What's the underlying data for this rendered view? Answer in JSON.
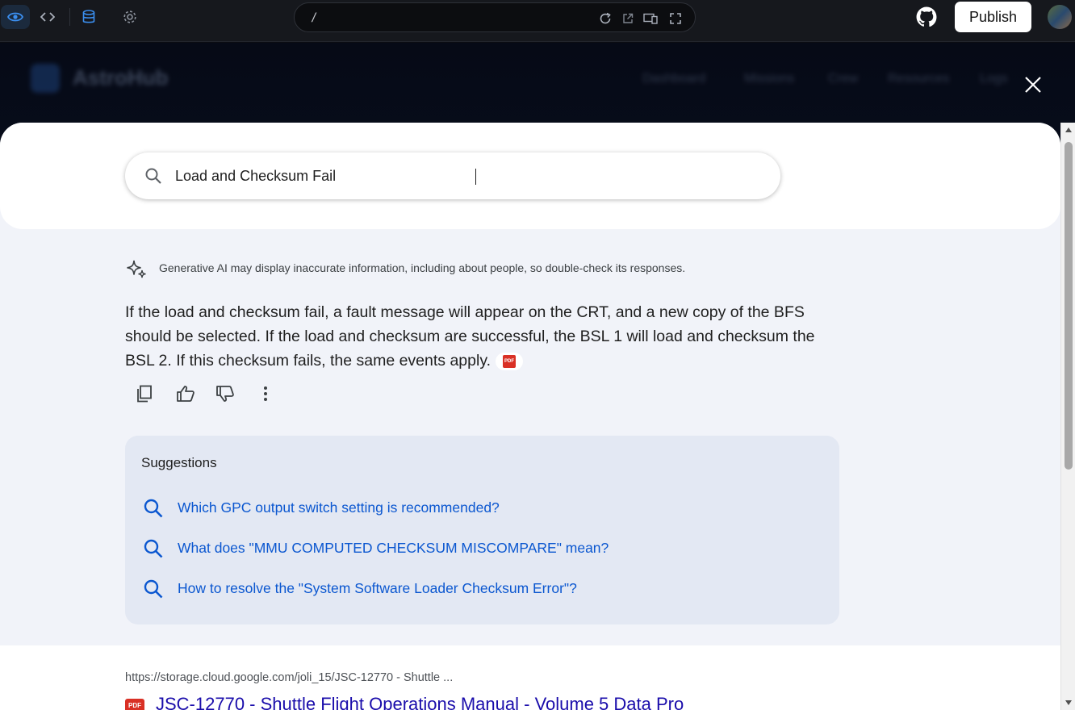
{
  "toolbar": {
    "path": "/",
    "publish_label": "Publish"
  },
  "app_bg": {
    "brand": "AstroHub",
    "links": [
      "Dashboard",
      "Missions",
      "Crew",
      "Resources",
      "Logs"
    ]
  },
  "search": {
    "value": "Load and Checksum Fail",
    "placeholder": ""
  },
  "disclaimer": "Generative AI may display inaccurate information, including about people, so double-check its responses.",
  "answer": "If the load and checksum fail, a fault message will appear on the CRT, and a new copy of the BFS should be selected. If the load and checksum are successful, the BSL 1 will load and checksum the BSL 2. If this checksum fails, the same events apply.",
  "pdf_label": "PDF",
  "suggestions": {
    "title": "Suggestions",
    "items": [
      "Which GPC output switch setting is recommended?",
      "What does \"MMU COMPUTED CHECKSUM MISCOMPARE\" mean?",
      "How to resolve the \"System Software Loader Checksum Error\"?"
    ]
  },
  "result": {
    "url": "https://storage.cloud.google.com/joli_15/JSC-12770 - Shuttle ...",
    "title": "JSC-12770 - Shuttle Flight Operations Manual - Volume 5 Data Pro"
  },
  "colors": {
    "accent": "#0b57d0",
    "toolbar_active": "#3b8ff0",
    "pdf": "#d93025"
  }
}
